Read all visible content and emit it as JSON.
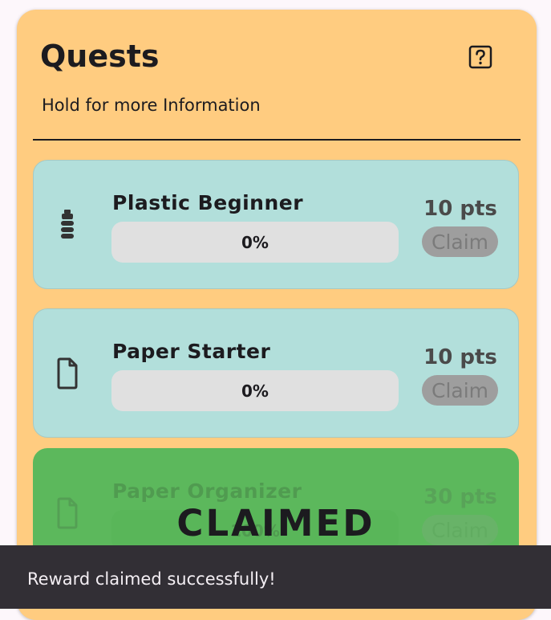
{
  "header": {
    "title": "Quests",
    "help_icon": "help-box-icon",
    "subtitle": "Hold for more Information"
  },
  "quests": [
    {
      "name": "Plastic Beginner",
      "icon": "plastic-bottle-icon",
      "progress_label": "0%",
      "progress_fraction": 0,
      "points": "10 pts",
      "claim_label": "Claim",
      "claimed": false
    },
    {
      "name": "Paper Starter",
      "icon": "document-icon",
      "progress_label": "0%",
      "progress_fraction": 0,
      "points": "10 pts",
      "claim_label": "Claim",
      "claimed": false
    },
    {
      "name": "Paper Organizer",
      "icon": "document-icon",
      "progress_label": "100%",
      "progress_fraction": 1,
      "points": "30 pts",
      "claim_label": "Claim",
      "claimed": true,
      "claimed_label": "CLAIMED"
    }
  ],
  "snackbar": {
    "message": "Reward claimed successfully!"
  },
  "colors": {
    "panel": "#ffcc80",
    "card": "#b2dfdb",
    "claimed_card": "#5cb85c",
    "progress_track": "#e0e0e0",
    "claim_button_disabled": "#9e9e9e",
    "snackbar": "#322f35"
  }
}
